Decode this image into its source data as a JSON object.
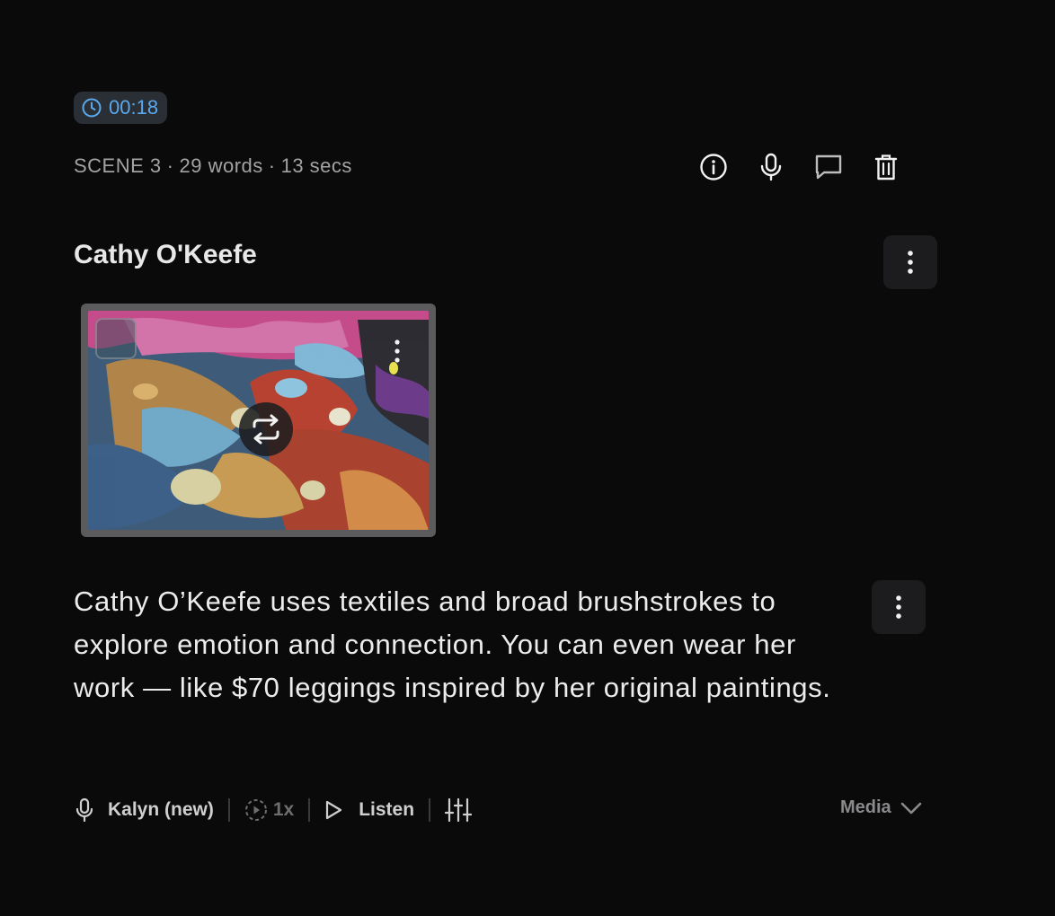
{
  "timer": {
    "value": "00:18",
    "icon": "clock-icon",
    "color": "#5aa9ee"
  },
  "scene": {
    "label": "SCENE 3",
    "words": "29 words",
    "duration": "13 secs",
    "separator": "·"
  },
  "toolbar": {
    "icons": [
      "info-icon",
      "microphone-icon",
      "comment-icon",
      "trash-icon"
    ]
  },
  "title": "Cathy O'Keefe",
  "narration": "Cathy O’Keefe uses textiles and broad brushstrokes to explore emotion and connection. You can even wear her work — like $70 leggings inspired by her original paintings.",
  "bottom_bar": {
    "voice": "Kalyn (new)",
    "speed": "1x",
    "listen": "Listen",
    "media": "Media"
  }
}
